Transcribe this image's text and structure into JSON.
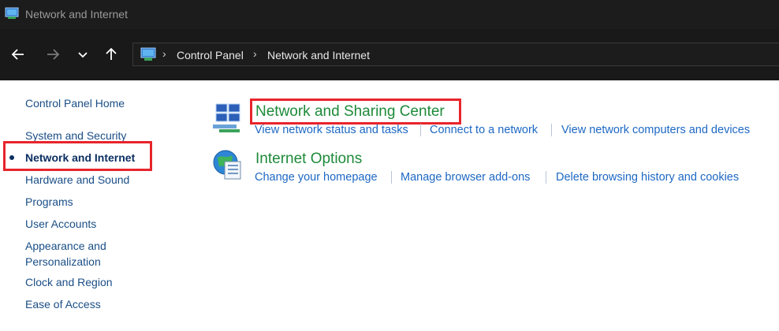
{
  "window": {
    "title": "Network and Internet",
    "icon": "control-panel-icon"
  },
  "navigation": {
    "back_icon": "arrow-left-icon",
    "forward_icon": "arrow-right-icon",
    "recent_icon": "chevron-down-icon",
    "up_icon": "arrow-up-icon",
    "breadcrumb": [
      "Control Panel",
      "Network and Internet"
    ]
  },
  "sidebar": {
    "items": [
      {
        "label": "Control Panel Home"
      },
      {
        "label": "System and Security"
      },
      {
        "label": "Network and Internet",
        "current": true
      },
      {
        "label": "Hardware and Sound"
      },
      {
        "label": "Programs"
      },
      {
        "label": "User Accounts"
      },
      {
        "label": "Appearance and"
      },
      {
        "label": "Personalization"
      },
      {
        "label": "Clock and Region"
      },
      {
        "label": "Ease of Access"
      }
    ]
  },
  "categories": [
    {
      "title": "Network and Sharing Center",
      "icon": "network-sharing-center-icon",
      "tasks": [
        "View network status and tasks",
        "Connect to a network",
        "View network computers and devices"
      ]
    },
    {
      "title": "Internet Options",
      "icon": "internet-options-icon",
      "tasks": [
        "Change your homepage",
        "Manage browser add-ons",
        "Delete browsing history and cookies"
      ]
    }
  ],
  "colors": {
    "highlight": "#e8242b",
    "link": "#1d68c4",
    "category_title": "#1e8a3a"
  }
}
